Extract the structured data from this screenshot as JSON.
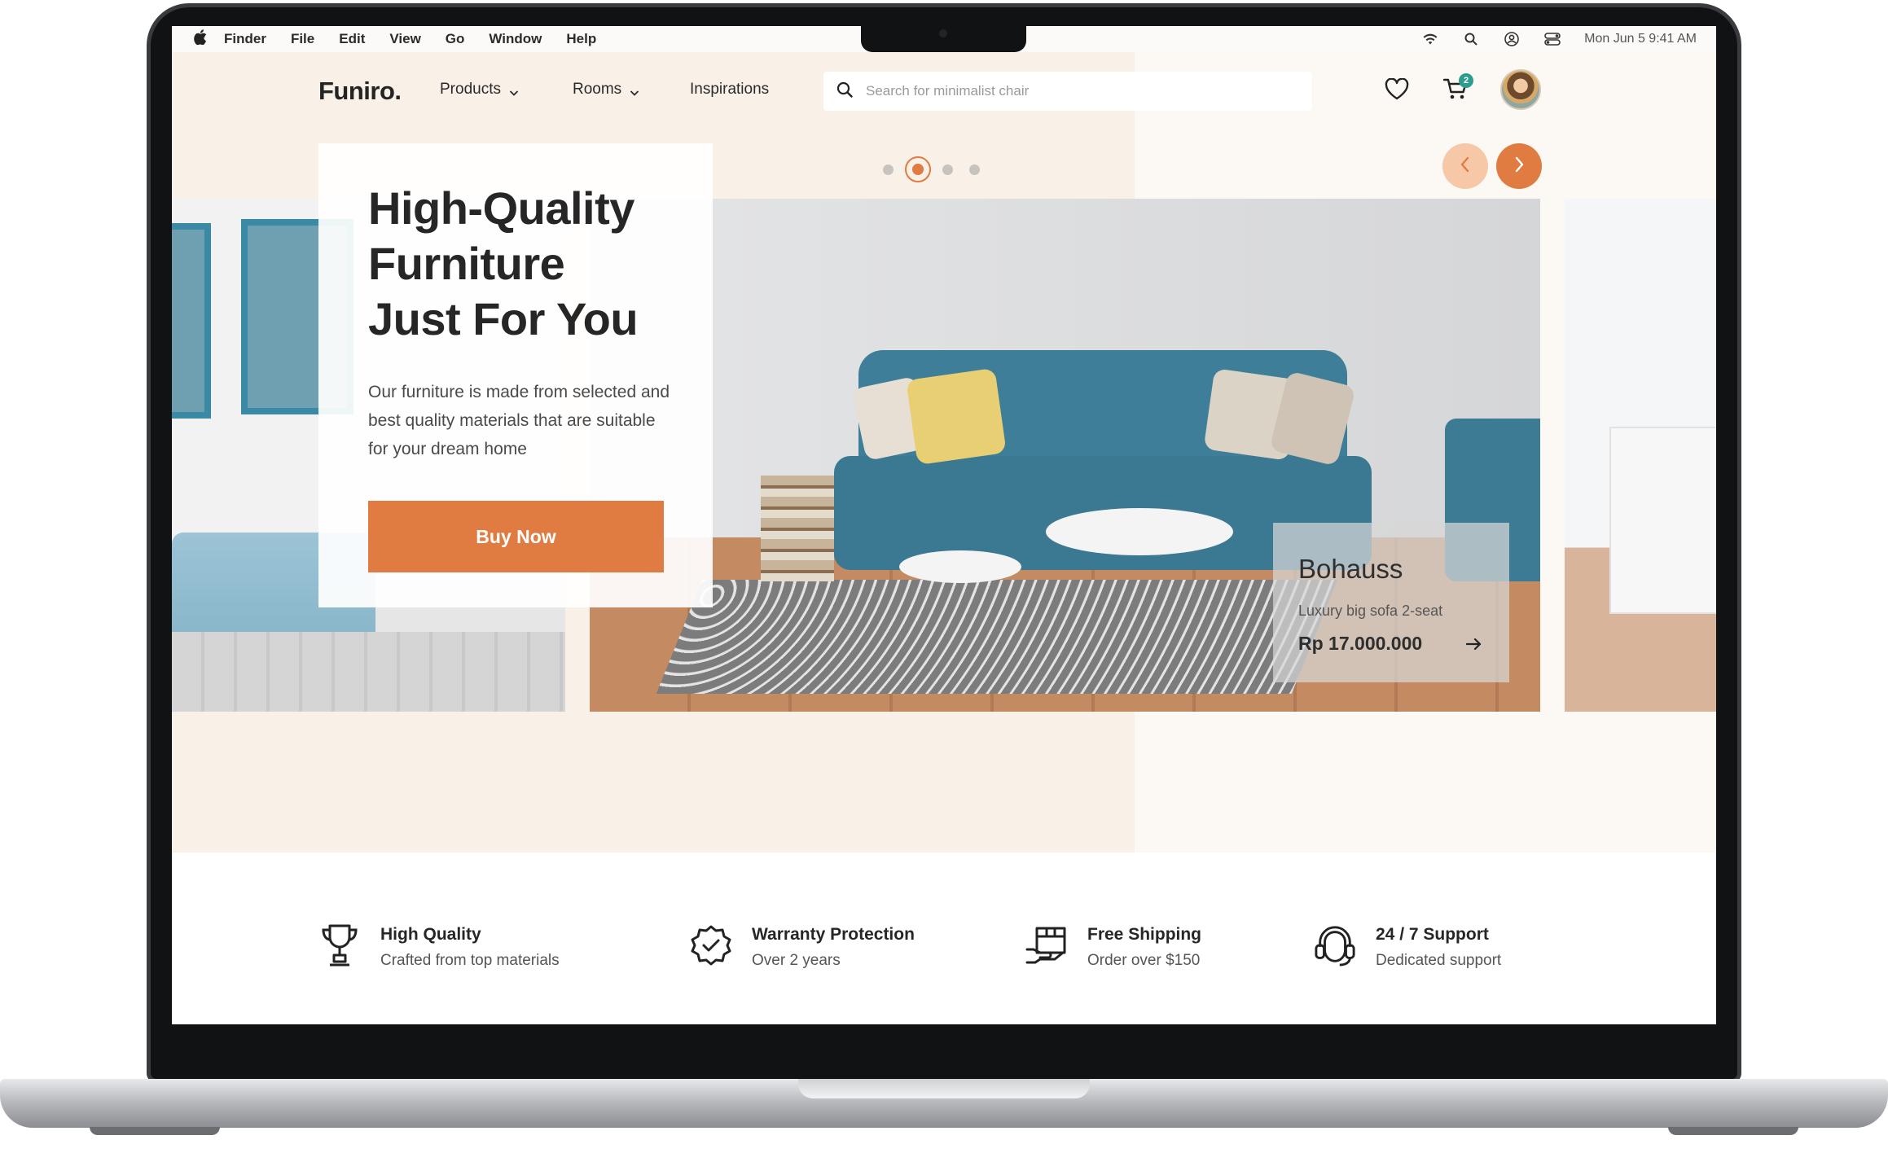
{
  "menubar": {
    "items": [
      "Finder",
      "File",
      "Edit",
      "View",
      "Go",
      "Window",
      "Help"
    ],
    "clock": "Mon Jun 5  9:41 AM",
    "status_icons": [
      "wifi-icon",
      "spotlight-search-icon",
      "user-account-icon",
      "control-center-icon"
    ]
  },
  "site": {
    "logo": "Funiro.",
    "nav": [
      {
        "label": "Products",
        "has_dropdown": true
      },
      {
        "label": "Rooms",
        "has_dropdown": true
      },
      {
        "label": "Inspirations",
        "has_dropdown": false
      }
    ],
    "search_placeholder": "Search for minimalist chair",
    "cart_count": "2",
    "icons": [
      "search-icon",
      "heart-icon",
      "cart-icon",
      "user-avatar"
    ]
  },
  "hero": {
    "title_line1": "High-Quality",
    "title_line2": "Furniture",
    "title_line3": "Just For You",
    "description": "Our furniture is made from selected and best quality materials that are suitable for your dream home",
    "cta_label": "Buy Now",
    "slides_count": 4,
    "active_slide": 2,
    "product": {
      "name": "Bohauss",
      "description": "Luxury big sofa 2-seat",
      "price": "Rp 17.000.000"
    }
  },
  "features": [
    {
      "icon": "trophy-icon",
      "title": "High Quality",
      "subtitle": "Crafted from top materials"
    },
    {
      "icon": "verified-check-icon",
      "title": "Warranty Protection",
      "subtitle": "Over 2 years"
    },
    {
      "icon": "shipping-box-icon",
      "title": "Free Shipping",
      "subtitle": "Order over $150"
    },
    {
      "icon": "support-headset-icon",
      "title": "24 / 7 Support",
      "subtitle": "Dedicated support"
    }
  ],
  "colors": {
    "accent": "#E07C42",
    "accent_light": "#F6C8A8",
    "hero_bg": "#F9F0E7",
    "badge": "#2A9D8F",
    "text_dark": "#262626"
  }
}
